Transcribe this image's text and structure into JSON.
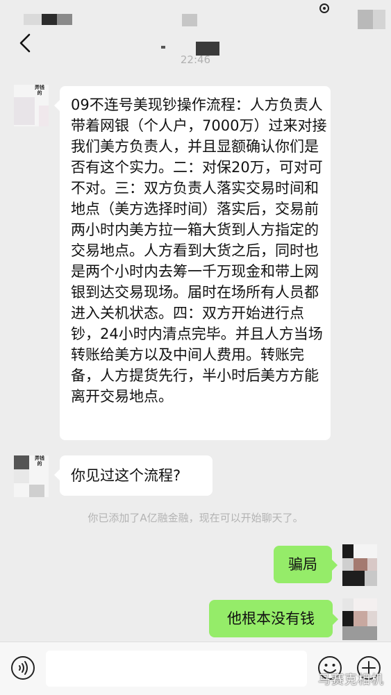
{
  "status_bar": {
    "clock": "22:46"
  },
  "messages": [
    {
      "side": "left",
      "sender_tag": "弄钱的",
      "text": "09不连号美现钞操作流程：人方负责人带着网银（个人户，7000万）过来对接我们美方负责人，并且显额确认你们是否有这个实力。二：对保20万，可对可不对。三：双方负责人落实交易时间和地点（美方选择时间）落实后，交易前两小时内美方拉一箱大货到人方指定的交易地点。人方看到大货之后，同时也是两个小时内去筹一千万现金和带上网银到达交易现场。届时在场所有人员都进入关机状态。四：双方开始进行点钞，24小时内清点完毕。并且人方当场转账给美方以及中间人费用。转账完备，人方提货先行，半小时后美方方能离开交易地点。"
    },
    {
      "side": "left",
      "sender_tag": "弄钱的",
      "text": "你见过这个流程?"
    },
    {
      "side": "right",
      "text": "骗局"
    },
    {
      "side": "right",
      "text": "他根本没有钱"
    }
  ],
  "system_note": "你已添加了A亿融金融，现在可以开始聊天了。",
  "input": {
    "value": ""
  },
  "icons": {
    "back": "chevron-left-icon",
    "voice": "voice-icon",
    "emoji": "emoji-icon",
    "plus": "plus-icon"
  },
  "colors": {
    "background": "#ededed",
    "bubble_left": "#ffffff",
    "bubble_right": "#95ec69"
  },
  "watermark": "马赛克相机"
}
